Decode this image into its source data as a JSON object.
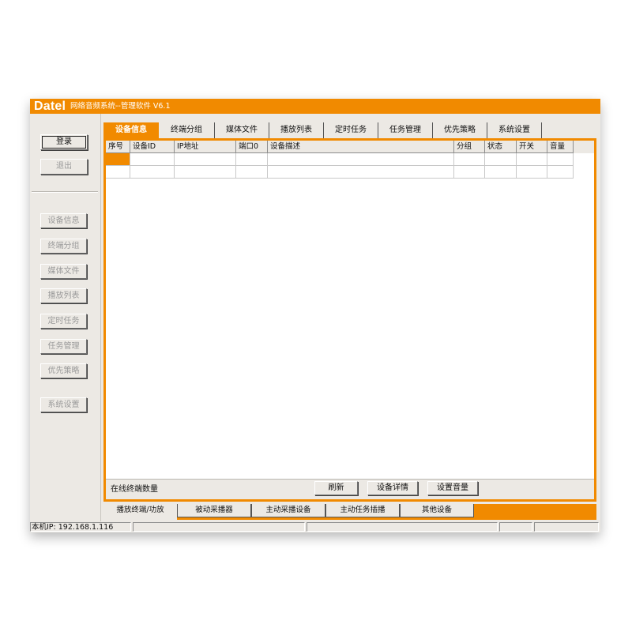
{
  "app": {
    "logo": "Datel",
    "title": "网络音频系统--管理软件 V6.1"
  },
  "sidebar": {
    "login_label": "登录",
    "logout_label": "退出",
    "items": [
      {
        "label": "设备信息"
      },
      {
        "label": "终端分组"
      },
      {
        "label": "媒体文件"
      },
      {
        "label": "播放列表"
      },
      {
        "label": "定时任务"
      },
      {
        "label": "任务管理"
      },
      {
        "label": "优先策略"
      },
      {
        "label": "系统设置"
      }
    ]
  },
  "tabs": [
    {
      "label": "设备信息",
      "active": true
    },
    {
      "label": "终端分组"
    },
    {
      "label": "媒体文件"
    },
    {
      "label": "播放列表"
    },
    {
      "label": "定时任务"
    },
    {
      "label": "任务管理"
    },
    {
      "label": "优先策略"
    },
    {
      "label": "系统设置"
    }
  ],
  "table": {
    "columns": [
      "序号",
      "设备ID",
      "IP地址",
      "端口0",
      "设备描述",
      "分组",
      "状态",
      "开关",
      "音量"
    ],
    "rows": [
      [
        "",
        "",
        "",
        "",
        "",
        "",
        "",
        "",
        ""
      ],
      [
        "",
        "",
        "",
        "",
        "",
        "",
        "",
        "",
        ""
      ]
    ]
  },
  "bottom": {
    "online_label": "在线终端数量",
    "refresh_label": "刷新",
    "details_label": "设备详情",
    "volume_label": "设置音量"
  },
  "subtabs": [
    {
      "label": "播放终端/功放",
      "active": true
    },
    {
      "label": "被动采播器"
    },
    {
      "label": "主动采播设备"
    },
    {
      "label": "主动任务插播"
    },
    {
      "label": "其他设备"
    }
  ],
  "status": {
    "local_ip": "本机IP: 192.168.1.116"
  },
  "colors": {
    "accent": "#f18a00",
    "window_bg": "#ece9e4"
  }
}
